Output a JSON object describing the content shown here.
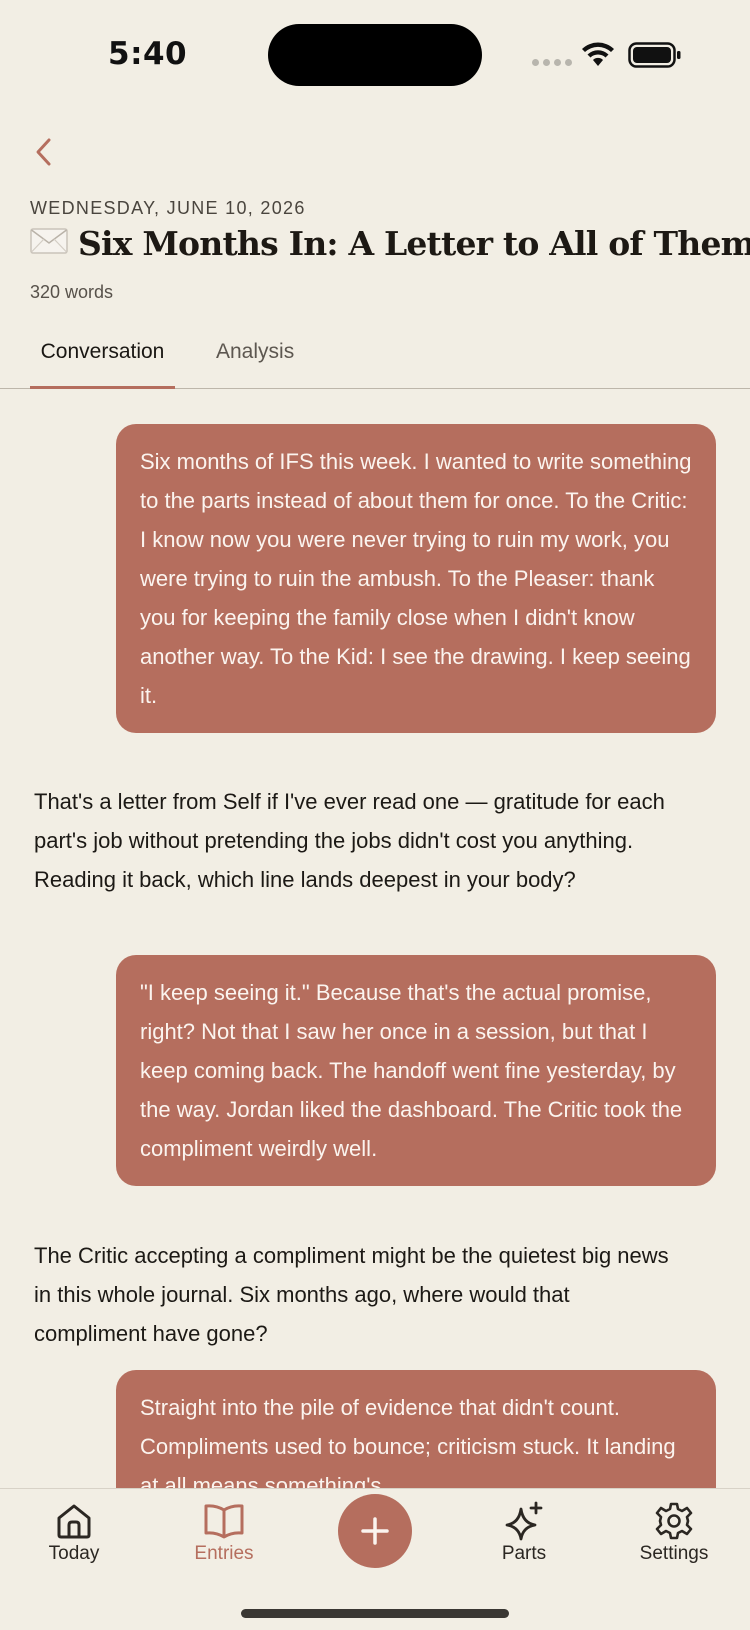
{
  "status_bar": {
    "time": "5:40"
  },
  "header": {
    "date": "WEDNESDAY, JUNE 10, 2026",
    "title": "Six Months In: A Letter to All of Them",
    "title_icon": "envelope-icon",
    "word_count": "320 words"
  },
  "tabs": [
    {
      "label": "Conversation",
      "active": true
    },
    {
      "label": "Analysis",
      "active": false
    }
  ],
  "messages": [
    {
      "role": "user",
      "text": "Six months of IFS this week. I wanted to write something to the parts instead of about them for once. To the Critic: I know now you were never trying to ruin my work, you were trying to ruin the ambush. To the Pleaser: thank you for keeping the family close when I didn't know another way. To the Kid: I see the drawing. I keep seeing it."
    },
    {
      "role": "assistant",
      "text": "That's a letter from Self if I've ever read one — gratitude for each part's job without pretending the jobs didn't cost you anything. Reading it back, which line lands deepest in your body?"
    },
    {
      "role": "user",
      "text": "\"I keep seeing it.\" Because that's the actual promise, right? Not that I saw her once in a session, but that I keep coming back. The handoff went fine yesterday, by the way. Jordan liked the dashboard. The Critic took the compliment weirdly well."
    },
    {
      "role": "assistant",
      "text": "The Critic accepting a compliment might be the quietest big news in this whole journal. Six months ago, where would that compliment have gone?"
    },
    {
      "role": "user",
      "text": "Straight into the pile of evidence that didn't count. Compliments used to bounce; criticism stuck. It landing at all means something's"
    }
  ],
  "tabbar": {
    "items": [
      {
        "label": "Today",
        "icon": "home-icon",
        "active": false
      },
      {
        "label": "Entries",
        "icon": "book-icon",
        "active": true
      },
      {
        "label": "Parts",
        "icon": "sparkle-icon",
        "active": false
      },
      {
        "label": "Settings",
        "icon": "gear-icon",
        "active": false
      }
    ],
    "add_icon": "plus-icon"
  },
  "colors": {
    "accent": "#b56e5e",
    "background": "#f2eee4",
    "text": "#1f1b16"
  }
}
